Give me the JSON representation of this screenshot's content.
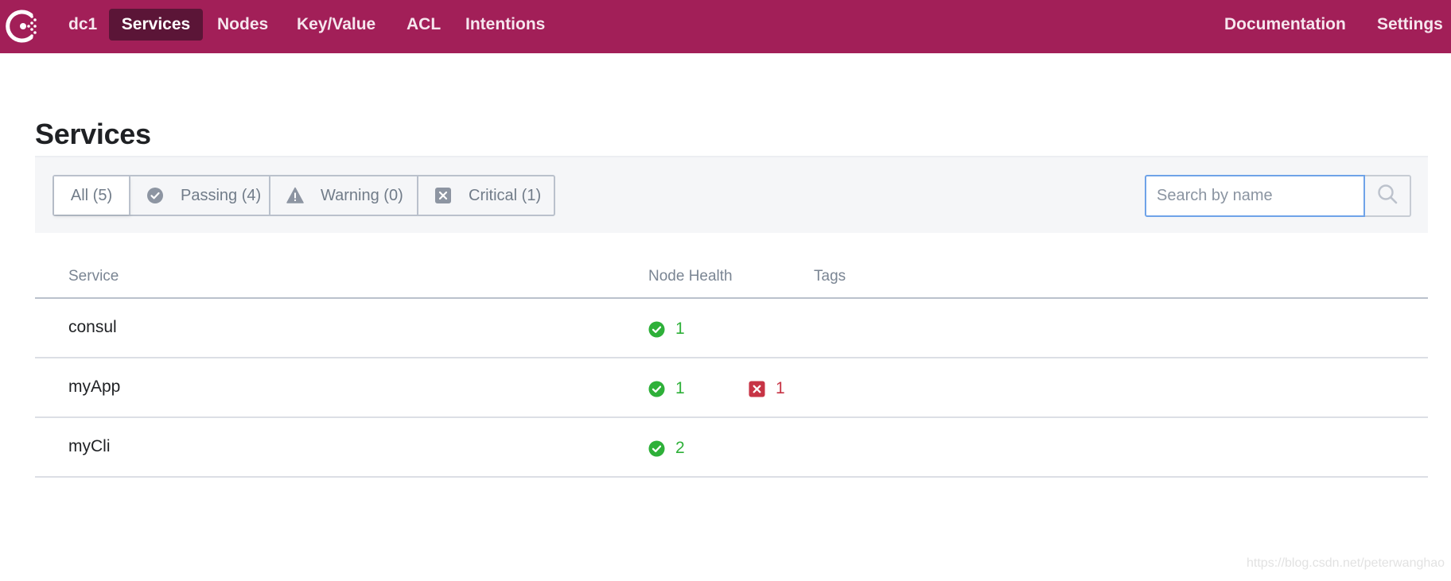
{
  "header": {
    "logo_icon": "consul-logo-icon",
    "datacenter": "dc1",
    "nav": [
      {
        "label": "Services",
        "active": true
      },
      {
        "label": "Nodes"
      },
      {
        "label": "Key/Value"
      },
      {
        "label": "ACL"
      },
      {
        "label": "Intentions"
      }
    ],
    "right_nav": [
      {
        "label": "Documentation"
      },
      {
        "label": "Settings"
      }
    ],
    "brand_color": "#a21f58"
  },
  "page": {
    "title": "Services"
  },
  "filters": {
    "options": [
      {
        "label": "All (5)",
        "active": true
      },
      {
        "label": "Passing (4)",
        "icon": "check-circle-icon"
      },
      {
        "label": "Warning (0)",
        "icon": "warning-icon"
      },
      {
        "label": "Critical (1)",
        "icon": "x-square-icon"
      }
    ],
    "search": {
      "value": "",
      "placeholder": "Search by name",
      "button_icon": "search-icon"
    }
  },
  "table": {
    "columns": [
      "Service",
      "Node Health",
      "Tags"
    ],
    "rows": [
      {
        "name": "consul",
        "passing": "1",
        "critical": null,
        "tags": ""
      },
      {
        "name": "myApp",
        "passing": "1",
        "critical": "1",
        "tags": ""
      },
      {
        "name": "myCli",
        "passing": "2",
        "critical": null,
        "tags": ""
      }
    ]
  },
  "status_colors": {
    "passing": "#2eb039",
    "critical": "#c73445"
  },
  "watermark": "https://blog.csdn.net/peterwanghao"
}
